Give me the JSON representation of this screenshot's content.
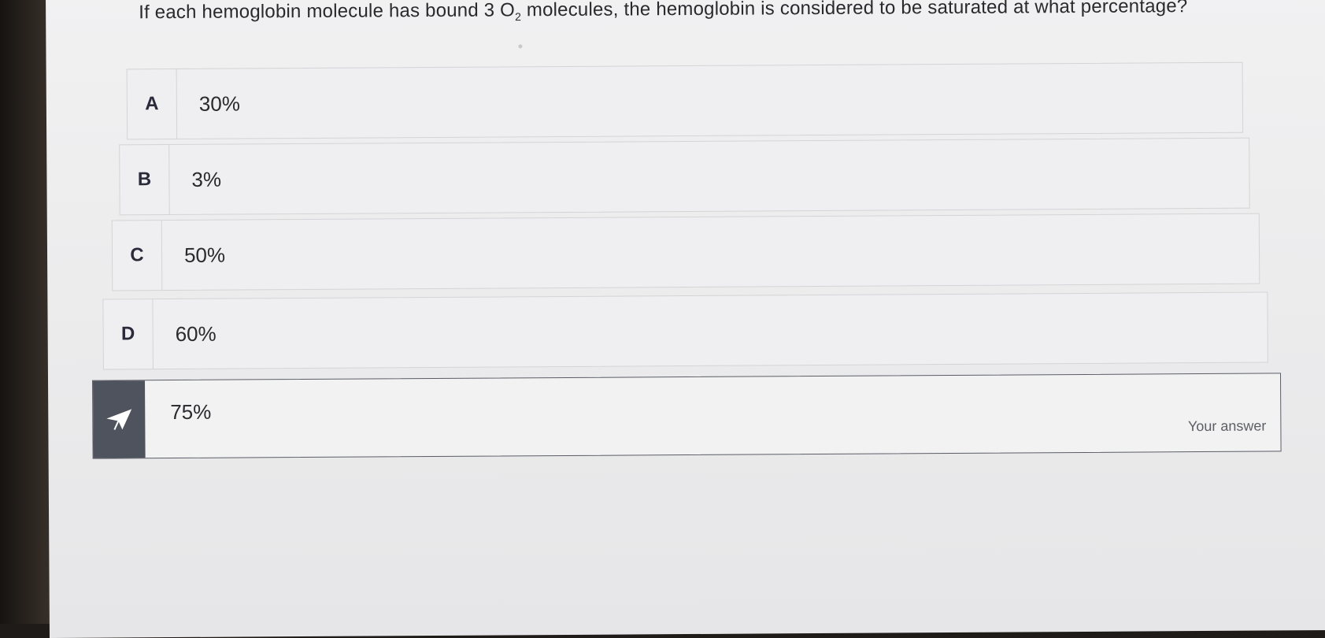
{
  "question": {
    "text_before": "If each hemoglobin molecule has bound 3 O",
    "subscript": "2",
    "text_after": " molecules, the hemoglobin is considered to be saturated at what percentage?"
  },
  "options": [
    {
      "letter": "A",
      "value": "30%"
    },
    {
      "letter": "B",
      "value": "3%"
    },
    {
      "letter": "C",
      "value": "50%"
    },
    {
      "letter": "D",
      "value": "60%"
    }
  ],
  "selected_answer": {
    "value": "75%",
    "label": "Your answer",
    "icon": "paper-plane-icon"
  },
  "colors": {
    "selected_tab": "#4f535d",
    "background": "#eeeeef",
    "border": "#d4d4d7"
  }
}
